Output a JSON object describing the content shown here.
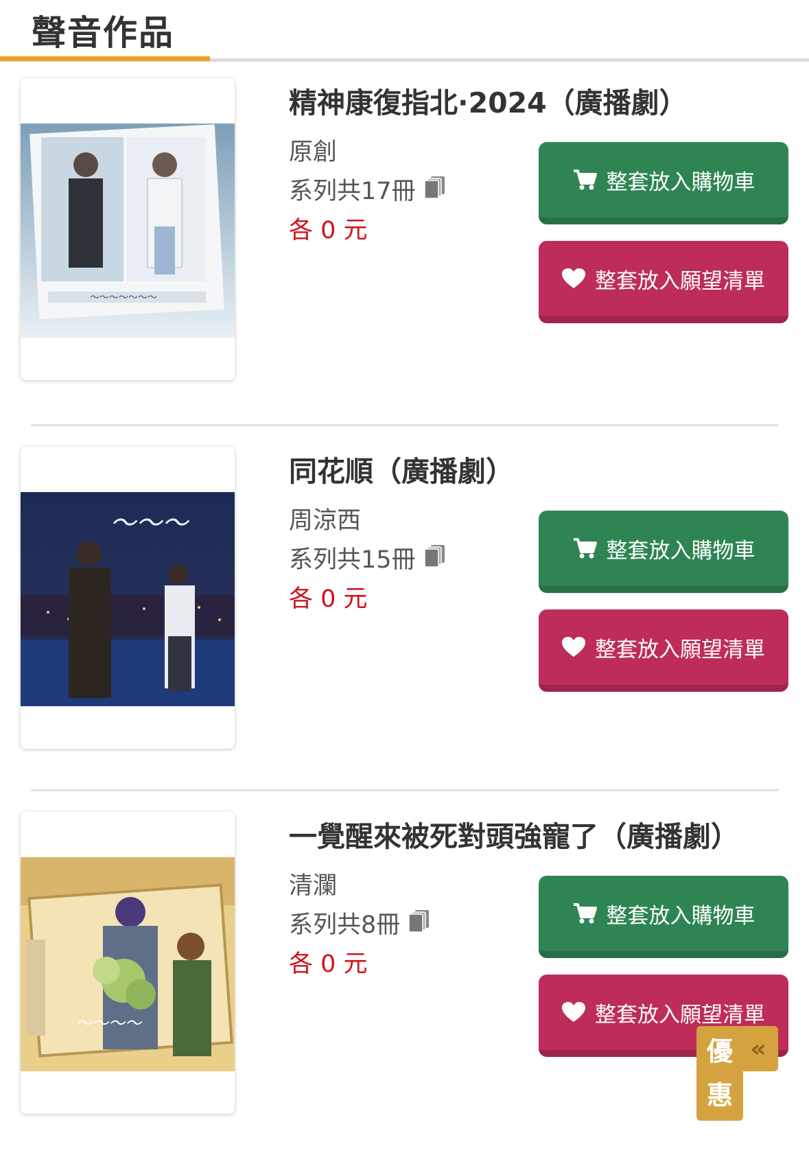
{
  "section": {
    "title": "聲音作品"
  },
  "products": [
    {
      "title": "精神康復指北·2024（廣播劇）",
      "author": "原創",
      "series": "系列共17冊",
      "price": "各 0 元",
      "cart_label": "整套放入購物車",
      "wish_label": "整套放入願望清單"
    },
    {
      "title": "同花順（廣播劇）",
      "author": "周涼西",
      "series": "系列共15冊",
      "price": "各 0 元",
      "cart_label": "整套放入購物車",
      "wish_label": "整套放入願望清單"
    },
    {
      "title": "一覺醒來被死對頭強寵了（廣播劇）",
      "author": "清瀾",
      "series": "系列共8冊",
      "price": "各 0 元",
      "cart_label": "整套放入購物車",
      "wish_label": "整套放入願望清單"
    }
  ],
  "promo": {
    "line1": "優",
    "line2": "惠",
    "collapse": "«"
  },
  "colors": {
    "accent": "#f0a020",
    "cart": "#2e8553",
    "wish": "#bd2d57",
    "price": "#d0121b",
    "promo": "#d4a340"
  },
  "icons": [
    "cart-icon",
    "heart-icon",
    "books-icon",
    "chevron-double-left-icon"
  ]
}
